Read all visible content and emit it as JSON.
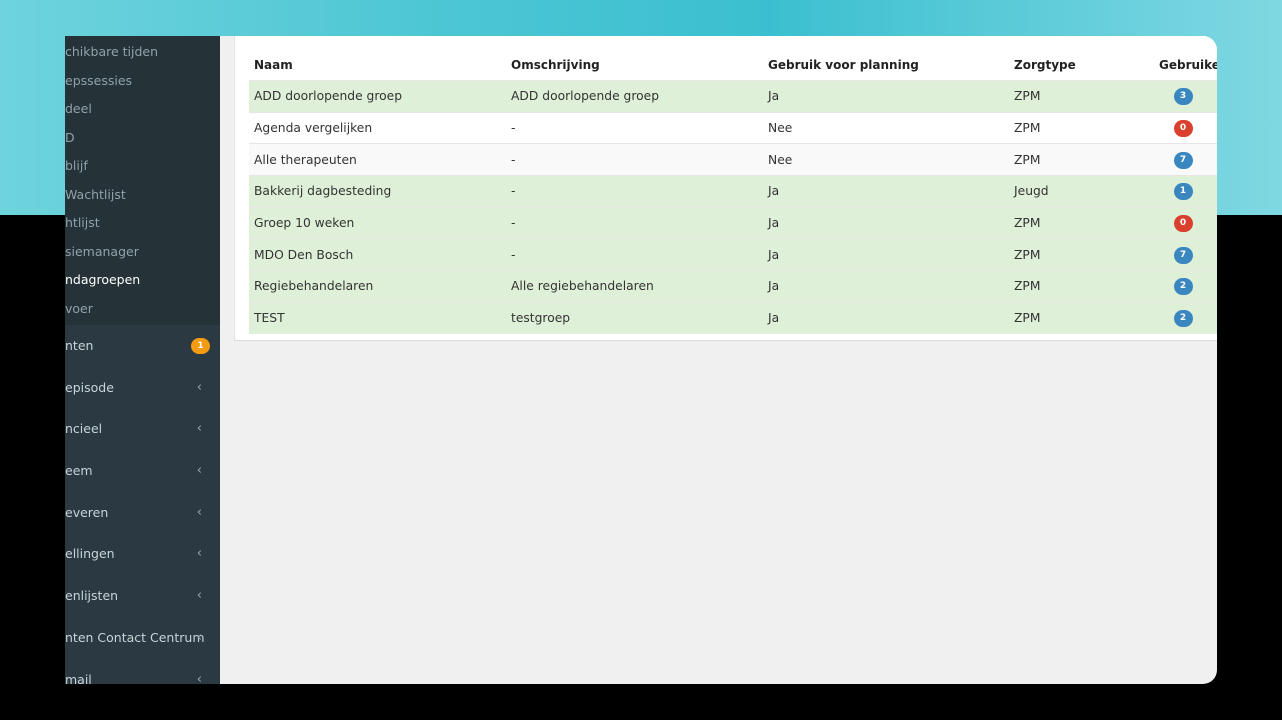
{
  "sidebar": {
    "sub_items": [
      "chikbare tijden",
      "epssessies",
      "deel",
      "D",
      "blijf",
      " Wachtlijst",
      "htlijst",
      "siemanager",
      "ndagroepen",
      "voer"
    ],
    "main_items": [
      {
        "label": "nten",
        "badge": "1"
      },
      {
        "label": "episode"
      },
      {
        "label": "ncieel"
      },
      {
        "label": "eem"
      },
      {
        "label": "everen"
      },
      {
        "label": "ellingen"
      },
      {
        "label": "enlijsten"
      },
      {
        "label": "nten Contact Centrum"
      },
      {
        "label": "mail"
      }
    ]
  },
  "table": {
    "headers": [
      "Naam",
      "Omschrijving",
      "Gebruik voor planning",
      "Zorgtype",
      "Gebruikers"
    ],
    "rows": [
      {
        "naam": "ADD doorlopende groep",
        "omschrijving": "ADD doorlopende groep",
        "planning": "Ja",
        "zorgtype": "ZPM",
        "gebruikers": "3"
      },
      {
        "naam": "Agenda vergelijken",
        "omschrijving": "-",
        "planning": "Nee",
        "zorgtype": "ZPM",
        "gebruikers": "0"
      },
      {
        "naam": "Alle therapeuten",
        "omschrijving": "-",
        "planning": "Nee",
        "zorgtype": "ZPM",
        "gebruikers": "7"
      },
      {
        "naam": "Bakkerij dagbesteding",
        "omschrijving": "-",
        "planning": "Ja",
        "zorgtype": "Jeugd",
        "gebruikers": "1"
      },
      {
        "naam": "Groep 10 weken",
        "omschrijving": "-",
        "planning": "Ja",
        "zorgtype": "ZPM",
        "gebruikers": "0"
      },
      {
        "naam": "MDO Den Bosch",
        "omschrijving": "-",
        "planning": "Ja",
        "zorgtype": "ZPM",
        "gebruikers": "7"
      },
      {
        "naam": "Regiebehandelaren",
        "omschrijving": "Alle regiebehandelaren",
        "planning": "Ja",
        "zorgtype": "ZPM",
        "gebruikers": "2"
      },
      {
        "naam": "TEST",
        "omschrijving": "testgroep",
        "planning": "Ja",
        "zorgtype": "ZPM",
        "gebruikers": "2"
      }
    ]
  },
  "colors": {
    "row_green": "#dff0d8",
    "badge_blue": "#3a87c0",
    "badge_red": "#d9412e",
    "badge_orange": "#f39c12",
    "sidebar_bg": "#2b3a42"
  }
}
